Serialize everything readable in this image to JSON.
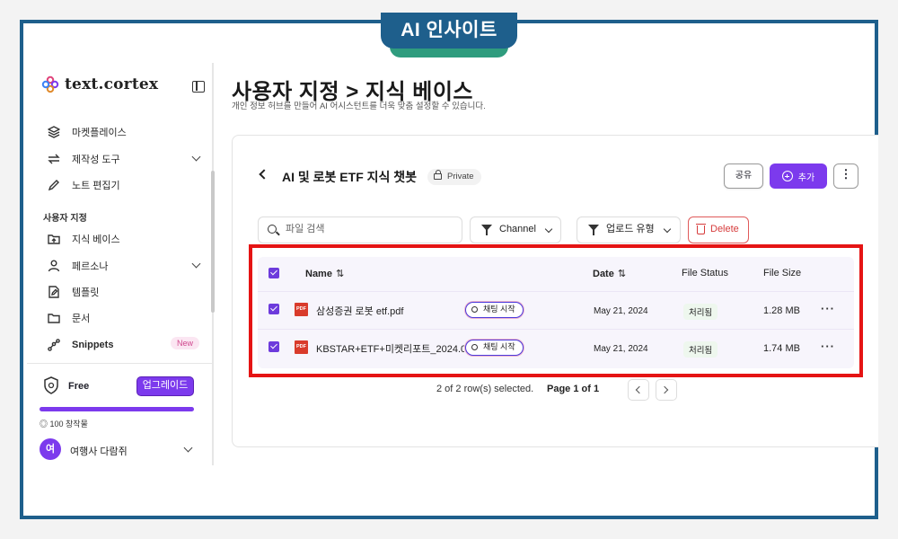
{
  "badge": {
    "label": "AI 인사이트"
  },
  "sidebar": {
    "brand": "text.cortex",
    "items": [
      {
        "label": "마켓플레이스",
        "icon": "layers-icon"
      },
      {
        "label": "제작성 도구",
        "icon": "repeat-icon",
        "has_chevron": true
      },
      {
        "label": "노트 편집기",
        "icon": "pen-icon"
      }
    ],
    "section_label": "사용자 지정",
    "custom_items": [
      {
        "label": "지식 베이스",
        "icon": "folder-upload-icon"
      },
      {
        "label": "페르소나",
        "icon": "person-icon",
        "has_chevron": true
      },
      {
        "label": "템플릿",
        "icon": "template-edit-icon"
      },
      {
        "label": "문서",
        "icon": "folder-icon"
      },
      {
        "label": "Snippets",
        "icon": "snippets-icon",
        "badge": "New"
      }
    ],
    "plan": {
      "name": "Free",
      "upgrade_label": "업그레이드",
      "credits": "◎ 100 창작물",
      "progress": 1.0
    },
    "user": {
      "initial": "여",
      "name": "여행사 다람쥐"
    }
  },
  "header": {
    "title": "사용자 지정 > 지식 베이스",
    "subtitle": "개인 정보 허브를 만들어 AI 어시스턴트를 더욱 맞춤 설정할 수 있습니다."
  },
  "knowledge_base": {
    "title": "AI 및 로봇 ETF 지식 챗봇",
    "visibility": "Private",
    "share_label": "공유",
    "add_label": "추가",
    "more_label": "⋮"
  },
  "toolbar": {
    "search_placeholder": "파일 검색",
    "channel_label": "Channel",
    "upload_type_label": "업로드 유형",
    "delete_label": "Delete"
  },
  "table": {
    "columns": {
      "name": "Name",
      "date": "Date",
      "status": "File Status",
      "size": "File Size"
    },
    "rows": [
      {
        "file": "삼성증권 로봇 etf.pdf",
        "chat_label": "채팅 시작",
        "date": "May 21, 2024",
        "status": "처리됨",
        "size": "1.28 MB"
      },
      {
        "file": "KBSTAR+ETF+미켓리포트_2024.0",
        "chat_label": "채팅 시작",
        "date": "May 21, 2024",
        "status": "처리됨",
        "size": "1.74 MB"
      }
    ],
    "row_more": "···"
  },
  "footer": {
    "selection": "2 of 2 row(s) selected.",
    "page": "Page 1 of 1"
  },
  "colors": {
    "accent": "#7c3aed",
    "highlight_box": "#e51414",
    "frame": "#1e5f8c",
    "delete": "#d63b3b"
  }
}
